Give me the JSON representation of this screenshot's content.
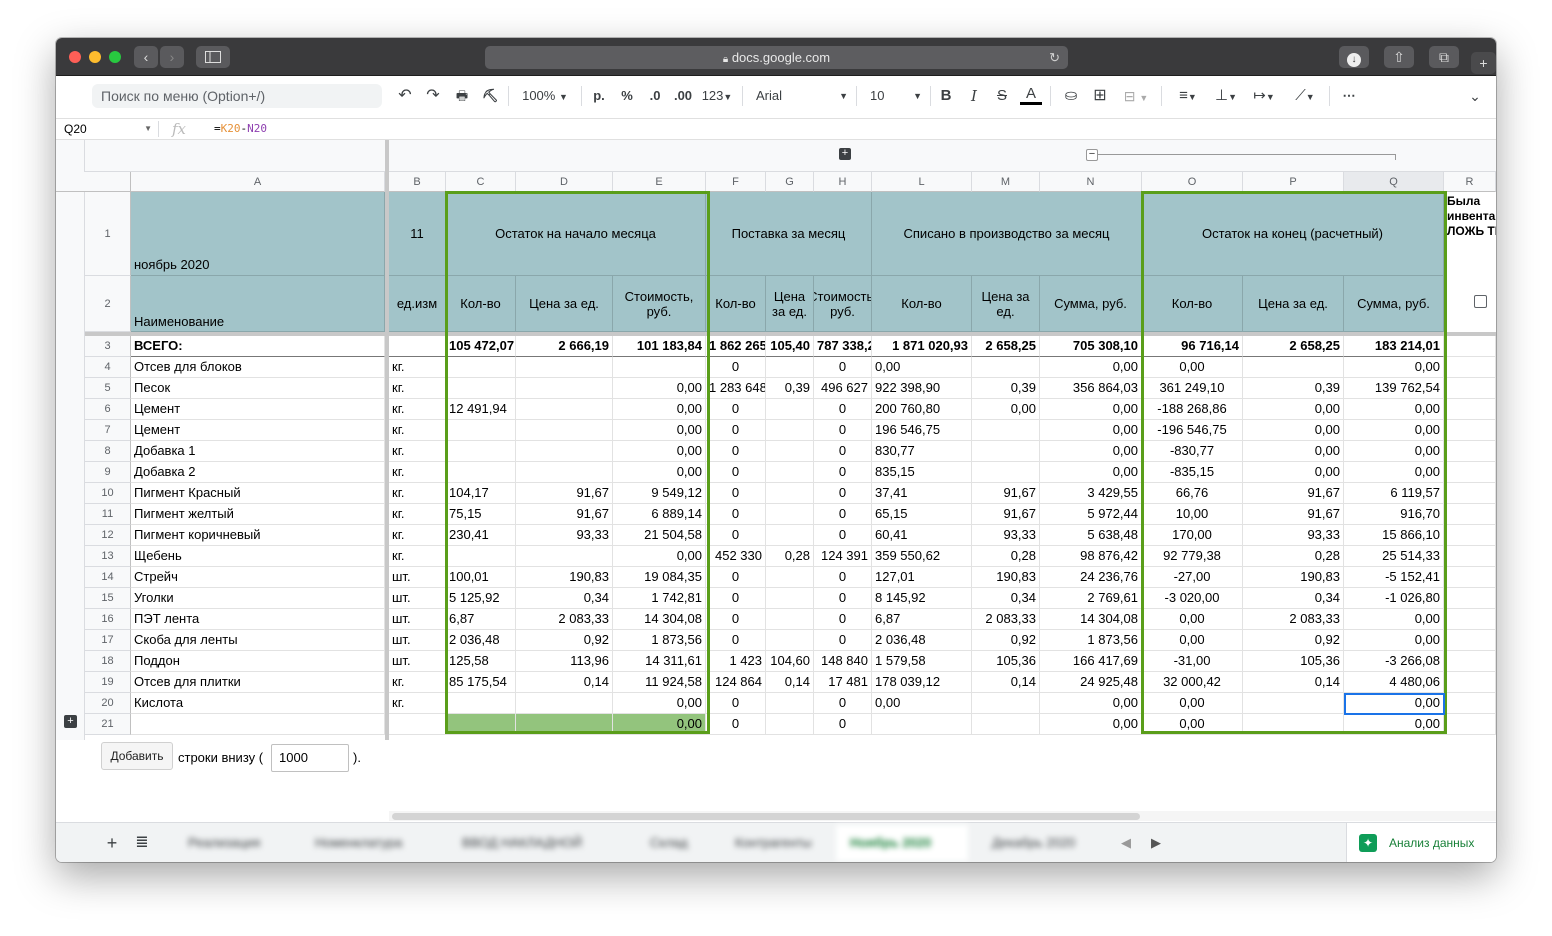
{
  "browser": {
    "url": "docs.google.com"
  },
  "toolbar": {
    "menu_search_placeholder": "Поиск по меню (Option+/)",
    "zoom": "100%",
    "currency": "р.",
    "percent": "%",
    "dec_less": ".0",
    "dec_more": ".00",
    "format_more": "123",
    "font": "Arial",
    "font_size": "10",
    "bold": "B",
    "italic": "I",
    "strike": "S",
    "text_color": "A",
    "more": "⋯"
  },
  "formula_bar": {
    "cell_ref": "Q20",
    "fx": "fx",
    "formula_eq": "=",
    "formula_ref1": "K20",
    "formula_op": "-",
    "formula_ref2": "N20"
  },
  "columns": [
    "A",
    "B",
    "C",
    "D",
    "E",
    "F",
    "G",
    "H",
    "L",
    "M",
    "N",
    "O",
    "P",
    "Q",
    "R"
  ],
  "header": {
    "title": "ноябрь 2020",
    "col_b_top": "11",
    "group_start": "Остаток на начало месяца",
    "group_supply": "Поставка за месяц",
    "group_written": "Списано в производство за месяц",
    "group_end": "Остаток на конец (расчетный)",
    "group_r": "Была инвентаризация ЛОЖЬ ТИНА",
    "name": "Наименование",
    "unit": "ед.изм",
    "qty": "Кол-во",
    "price": "Цена за ед.",
    "cost": "Стоимость, руб.",
    "supply_qty": "Кол-во",
    "supply_price": "Цена за ед.",
    "supply_cost": "Стоимость, руб.",
    "written_qty": "Кол-во",
    "written_price": "Цена за ед.",
    "written_sum": "Сумма, руб.",
    "end_qty": "Кол-во",
    "end_price": "Цена за ед.",
    "end_sum": "Сумма, руб."
  },
  "rows": [
    {
      "n": "3",
      "a": "ВСЕГО:",
      "b": "",
      "c": "105 472,07",
      "d": "2 666,19",
      "e": "101 183,84",
      "f": "1 862 265",
      "g": "105,40",
      "h": "787 338,2",
      "l": "1 871 020,93",
      "m": "2 658,25",
      "nn": "705 308,10",
      "o": "96 716,14",
      "p": "2 658,25",
      "q": "183 214,01"
    },
    {
      "n": "4",
      "a": "Отсев для блоков",
      "b": "кг.",
      "c": "",
      "d": "",
      "e": "",
      "f": "0",
      "g": "",
      "h": "0",
      "l": "0,00",
      "m": "",
      "nn": "0,00",
      "o": "0,00",
      "p": "",
      "q": "0,00"
    },
    {
      "n": "5",
      "a": "Песок",
      "b": "кг.",
      "c": "",
      "d": "",
      "e": "0,00",
      "f": "1 283 648",
      "g": "0,39",
      "h": "496 627",
      "l": "922 398,90",
      "m": "0,39",
      "nn": "356 864,03",
      "o": "361 249,10",
      "p": "0,39",
      "q": "139 762,54"
    },
    {
      "n": "6",
      "a": "Цемент",
      "b": "кг.",
      "c": "12 491,94",
      "d": "",
      "e": "0,00",
      "f": "0",
      "g": "",
      "h": "0",
      "l": "200 760,80",
      "m": "0,00",
      "nn": "0,00",
      "o": "-188 268,86",
      "p": "0,00",
      "q": "0,00"
    },
    {
      "n": "7",
      "a": "Цемент",
      "b": "кг.",
      "c": "",
      "d": "",
      "e": "0,00",
      "f": "0",
      "g": "",
      "h": "0",
      "l": "196 546,75",
      "m": "",
      "nn": "0,00",
      "o": "-196 546,75",
      "p": "0,00",
      "q": "0,00"
    },
    {
      "n": "8",
      "a": "Добавка 1",
      "b": "кг.",
      "c": "",
      "d": "",
      "e": "0,00",
      "f": "0",
      "g": "",
      "h": "0",
      "l": "830,77",
      "m": "",
      "nn": "0,00",
      "o": "-830,77",
      "p": "0,00",
      "q": "0,00"
    },
    {
      "n": "9",
      "a": "Добавка 2",
      "b": "кг.",
      "c": "",
      "d": "",
      "e": "0,00",
      "f": "0",
      "g": "",
      "h": "0",
      "l": "835,15",
      "m": "",
      "nn": "0,00",
      "o": "-835,15",
      "p": "0,00",
      "q": "0,00"
    },
    {
      "n": "10",
      "a": "Пигмент Красный",
      "b": "кг.",
      "c": "104,17",
      "d": "91,67",
      "e": "9 549,12",
      "f": "0",
      "g": "",
      "h": "0",
      "l": "37,41",
      "m": "91,67",
      "nn": "3 429,55",
      "o": "66,76",
      "p": "91,67",
      "q": "6 119,57"
    },
    {
      "n": "11",
      "a": "Пигмент желтый",
      "b": "кг.",
      "c": "75,15",
      "d": "91,67",
      "e": "6 889,14",
      "f": "0",
      "g": "",
      "h": "0",
      "l": "65,15",
      "m": "91,67",
      "nn": "5 972,44",
      "o": "10,00",
      "p": "91,67",
      "q": "916,70"
    },
    {
      "n": "12",
      "a": "Пигмент коричневый",
      "b": "кг.",
      "c": "230,41",
      "d": "93,33",
      "e": "21 504,58",
      "f": "0",
      "g": "",
      "h": "0",
      "l": "60,41",
      "m": "93,33",
      "nn": "5 638,48",
      "o": "170,00",
      "p": "93,33",
      "q": "15 866,10"
    },
    {
      "n": "13",
      "a": "Щебень",
      "b": "кг.",
      "c": "",
      "d": "",
      "e": "0,00",
      "f": "452 330",
      "g": "0,28",
      "h": "124 391",
      "l": "359 550,62",
      "m": "0,28",
      "nn": "98 876,42",
      "o": "92 779,38",
      "p": "0,28",
      "q": "25 514,33"
    },
    {
      "n": "14",
      "a": "Стрейч",
      "b": "шт.",
      "c": "100,01",
      "d": "190,83",
      "e": "19 084,35",
      "f": "0",
      "g": "",
      "h": "0",
      "l": "127,01",
      "m": "190,83",
      "nn": "24 236,76",
      "o": "-27,00",
      "p": "190,83",
      "q": "-5 152,41"
    },
    {
      "n": "15",
      "a": "Уголки",
      "b": "шт.",
      "c": "5 125,92",
      "d": "0,34",
      "e": "1 742,81",
      "f": "0",
      "g": "",
      "h": "0",
      "l": "8 145,92",
      "m": "0,34",
      "nn": "2 769,61",
      "o": "-3 020,00",
      "p": "0,34",
      "q": "-1 026,80"
    },
    {
      "n": "16",
      "a": "ПЭТ лента",
      "b": "шт.",
      "c": "6,87",
      "d": "2 083,33",
      "e": "14 304,08",
      "f": "0",
      "g": "",
      "h": "0",
      "l": "6,87",
      "m": "2 083,33",
      "nn": "14 304,08",
      "o": "0,00",
      "p": "2 083,33",
      "q": "0,00"
    },
    {
      "n": "17",
      "a": "Скоба для ленты",
      "b": "шт.",
      "c": "2 036,48",
      "d": "0,92",
      "e": "1 873,56",
      "f": "0",
      "g": "",
      "h": "0",
      "l": "2 036,48",
      "m": "0,92",
      "nn": "1 873,56",
      "o": "0,00",
      "p": "0,92",
      "q": "0,00"
    },
    {
      "n": "18",
      "a": "Поддон",
      "b": "шт.",
      "c": "125,58",
      "d": "113,96",
      "e": "14 311,61",
      "f": "1 423",
      "g": "104,60",
      "h": "148 840",
      "l": "1 579,58",
      "m": "105,36",
      "nn": "166 417,69",
      "o": "-31,00",
      "p": "105,36",
      "q": "-3 266,08"
    },
    {
      "n": "19",
      "a": "Отсев для плитки",
      "b": "кг.",
      "c": "85 175,54",
      "d": "0,14",
      "e": "11 924,58",
      "f": "124 864",
      "g": "0,14",
      "h": "17 481",
      "l": "178 039,12",
      "m": "0,14",
      "nn": "24 925,48",
      "o": "32 000,42",
      "p": "0,14",
      "q": "4 480,06"
    },
    {
      "n": "20",
      "a": "Кислота",
      "b": "кг.",
      "c": "",
      "d": "",
      "e": "0,00",
      "f": "0",
      "g": "",
      "h": "0",
      "l": "0,00",
      "m": "",
      "nn": "0,00",
      "o": "0,00",
      "p": "",
      "q": "0,00"
    },
    {
      "n": "21",
      "a": "",
      "b": "",
      "c": "",
      "d": "",
      "e": "0,00",
      "f": "0",
      "g": "",
      "h": "0",
      "l": "",
      "m": "",
      "nn": "0,00",
      "o": "0,00",
      "p": "",
      "q": "0,00"
    }
  ],
  "add_rows": {
    "button": "Добавить",
    "text_before": "строки внизу (",
    "count": "1000",
    "text_after": ")."
  },
  "sheet_tabs": [
    {
      "label": "Реализация"
    },
    {
      "label": "Номенклатура"
    },
    {
      "label": "ВВОД НАКЛАДНОЙ"
    },
    {
      "label": "Склад"
    },
    {
      "label": "Контрагенты"
    },
    {
      "label": "Ноябрь 2020",
      "active": true
    },
    {
      "label": "Декабрь 2020"
    }
  ],
  "explore_label": "Анализ данных",
  "colors": {
    "header_fill": "#a2c4c9",
    "group_border": "#5a9e1a",
    "selected_cell": "#1a73e8",
    "green_fill": "#93c47d"
  }
}
